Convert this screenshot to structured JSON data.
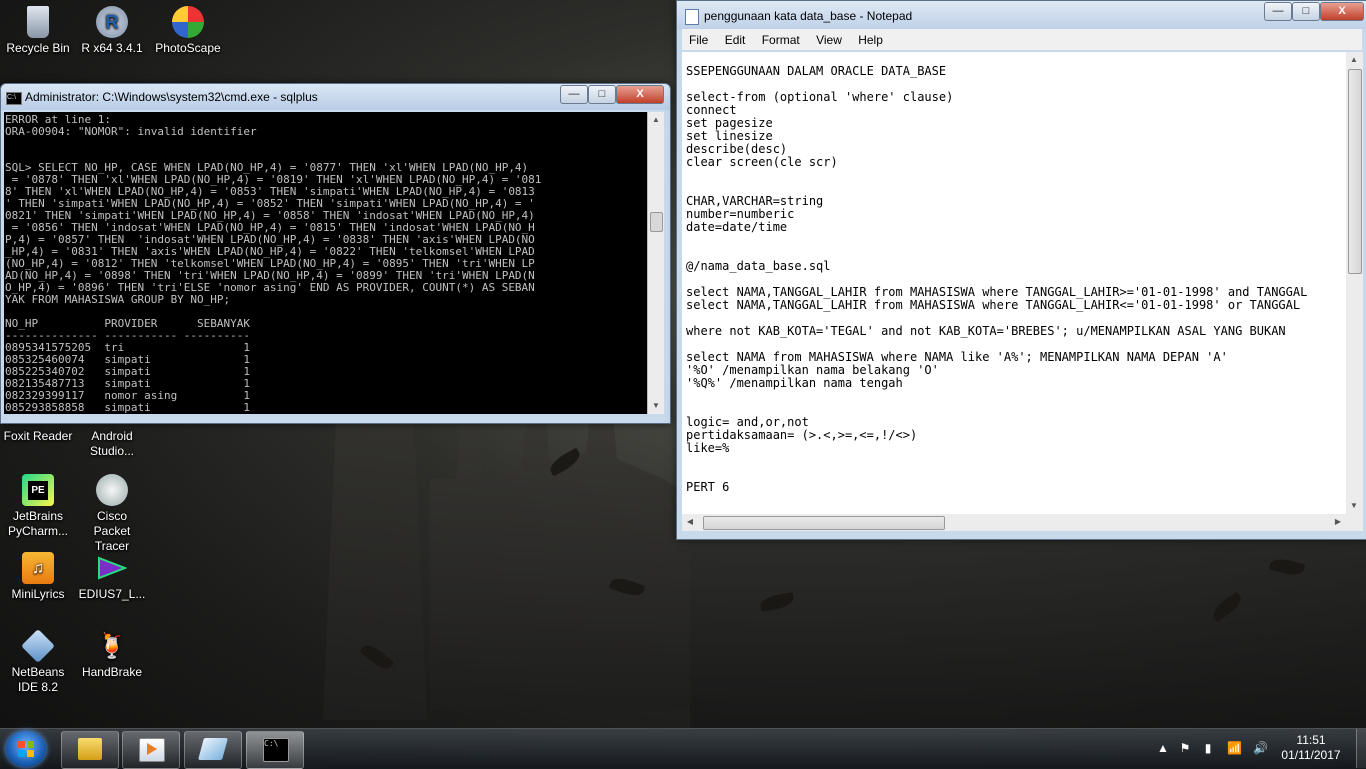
{
  "desktop": {
    "icons": [
      {
        "label": "Recycle Bin"
      },
      {
        "label": "R x64 3.4.1"
      },
      {
        "label": "PhotoScape"
      },
      {
        "label": "Foxit Reader"
      },
      {
        "label": "Android Studio..."
      },
      {
        "label": "JetBrains PyCharm..."
      },
      {
        "label": "Cisco Packet Tracer"
      },
      {
        "label": "MiniLyrics"
      },
      {
        "label": "EDIUS7_L..."
      },
      {
        "label": "NetBeans IDE 8.2"
      },
      {
        "label": "HandBrake"
      }
    ]
  },
  "cmd": {
    "title": "Administrator: C:\\Windows\\system32\\cmd.exe - sqlplus",
    "icon_text": "C:\\",
    "buttons": {
      "minimize": "—",
      "maximize": "□",
      "close": "X"
    },
    "lines": [
      "ERROR at line 1:",
      "ORA-00904: \"NOMOR\": invalid identifier",
      "",
      "",
      "SQL> SELECT NO_HP, CASE WHEN LPAD(NO_HP,4) = '0877' THEN 'xl'WHEN LPAD(NO_HP,4)",
      " = '0878' THEN 'xl'WHEN LPAD(NO_HP,4) = '0819' THEN 'xl'WHEN LPAD(NO_HP,4) = '081",
      "8' THEN 'xl'WHEN LPAD(NO_HP,4) = '0853' THEN 'simpati'WHEN LPAD(NO_HP,4) = '0813",
      "' THEN 'simpati'WHEN LPAD(NO_HP,4) = '0852' THEN 'simpati'WHEN LPAD(NO_HP,4) = '",
      "0821' THEN 'simpati'WHEN LPAD(NO_HP,4) = '0858' THEN 'indosat'WHEN LPAD(NO_HP,4)",
      " = '0856' THEN 'indosat'WHEN LPAD(NO_HP,4) = '0815' THEN 'indosat'WHEN LPAD(NO_H",
      "P,4) = '0857' THEN  'indosat'WHEN LPAD(NO_HP,4) = '0838' THEN 'axis'WHEN LPAD(NO",
      "_HP,4) = '0831' THEN 'axis'WHEN LPAD(NO_HP,4) = '0822' THEN 'telkomsel'WHEN LPAD",
      "(NO_HP,4) = '0812' THEN 'telkomsel'WHEN LPAD(NO_HP,4) = '0895' THEN 'tri'WHEN LP",
      "AD(NO_HP,4) = '0898' THEN 'tri'WHEN LPAD(NO_HP,4) = '0899' THEN 'tri'WHEN LPAD(N",
      "O_HP,4) = '0896' THEN 'tri'ELSE 'nomor asing' END AS PROVIDER, COUNT(*) AS SEBAN",
      "YAK FROM MAHASISWA GROUP BY NO_HP;",
      "",
      "NO_HP          PROVIDER      SEBANYAK",
      "-------------- ----------- ----------",
      "0895341575205  tri                  1",
      "085325460074   simpati              1",
      "085225340702   simpati              1",
      "082135487713   simpati              1",
      "082329399117   nomor asing          1",
      "085293858858   simpati              1"
    ]
  },
  "notepad": {
    "title": "penggunaan kata data_base - Notepad",
    "buttons": {
      "minimize": "—",
      "maximize": "□",
      "close": "X"
    },
    "menu": [
      "File",
      "Edit",
      "Format",
      "View",
      "Help"
    ],
    "lines": [
      "",
      "SSEPENGGUNAAN DALAM ORACLE DATA_BASE",
      "",
      "select-from (optional 'where' clause)",
      "connect",
      "set pagesize",
      "set linesize",
      "describe(desc)",
      "clear screen(cle scr)",
      "",
      "",
      "CHAR,VARCHAR=string",
      "number=numberic",
      "date=date/time",
      "",
      "",
      "@/nama_data_base.sql",
      "",
      "select NAMA,TANGGAL_LAHIR from MAHASISWA where TANGGAL_LAHIR>='01-01-1998' and TANGGAL",
      "select NAMA,TANGGAL_LAHIR from MAHASISWA where TANGGAL_LAHIR<='01-01-1998' or TANGGAL",
      "",
      "where not KAB_KOTA='TEGAL' and not KAB_KOTA='BREBES'; u/MENAMPILKAN ASAL YANG BUKAN",
      "",
      "select NAMA from MAHASISWA where NAMA like 'A%'; MENAMPILKAN NAMA DEPAN 'A'",
      "'%O' /menampilkan nama belakang 'O'",
      "'%Q%' /menampilkan nama tengah",
      "",
      "",
      "logic= and,or,not",
      "pertidaksamaan= (>.<,>=,<=,!/<>)",
      "like=%",
      "",
      "",
      "PERT 6"
    ]
  },
  "taskbar": {
    "clock_time": "11:51",
    "clock_date": "01/11/2017"
  },
  "colors": {
    "console_bg": "#000000",
    "console_text": "#c0c0c0",
    "window_frame": "#c9d9ec"
  }
}
